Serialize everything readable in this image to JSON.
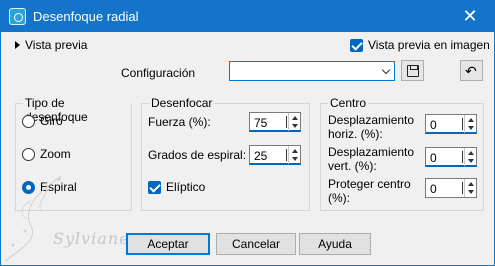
{
  "window": {
    "title": "Desenfoque radial",
    "close_label": "✕"
  },
  "preview": {
    "toggle_label": "Vista previa",
    "in_image_label": "Vista previa en imagen",
    "in_image_checked": true
  },
  "config": {
    "label": "Configuración",
    "value": ""
  },
  "blur_type": {
    "title": "Tipo de desenfoque",
    "options": [
      {
        "label": "Giro",
        "checked": false
      },
      {
        "label": "Zoom",
        "checked": false
      },
      {
        "label": "Espiral",
        "checked": true
      }
    ]
  },
  "blur": {
    "title": "Desenfocar",
    "strength_label": "Fuerza (%):",
    "strength_value": "75",
    "spiral_label": "Grados de espiral:",
    "spiral_value": "25",
    "elliptic_label": "Elíptico",
    "elliptic_checked": true
  },
  "center": {
    "title": "Centro",
    "horiz_label_1": "Desplazamiento",
    "horiz_label_2": "horiz. (%):",
    "horiz_value": "0",
    "vert_label_1": "Desplazamiento",
    "vert_label_2": "vert. (%):",
    "vert_value": "0",
    "protect_label_1": "Proteger centro",
    "protect_label_2": "(%):",
    "protect_value": "0"
  },
  "buttons": {
    "ok": "Aceptar",
    "cancel": "Cancelar",
    "help": "Ayuda"
  },
  "watermark": "Sylviane",
  "colors": {
    "titlebar": "#1474c9",
    "accent": "#0067c0"
  }
}
